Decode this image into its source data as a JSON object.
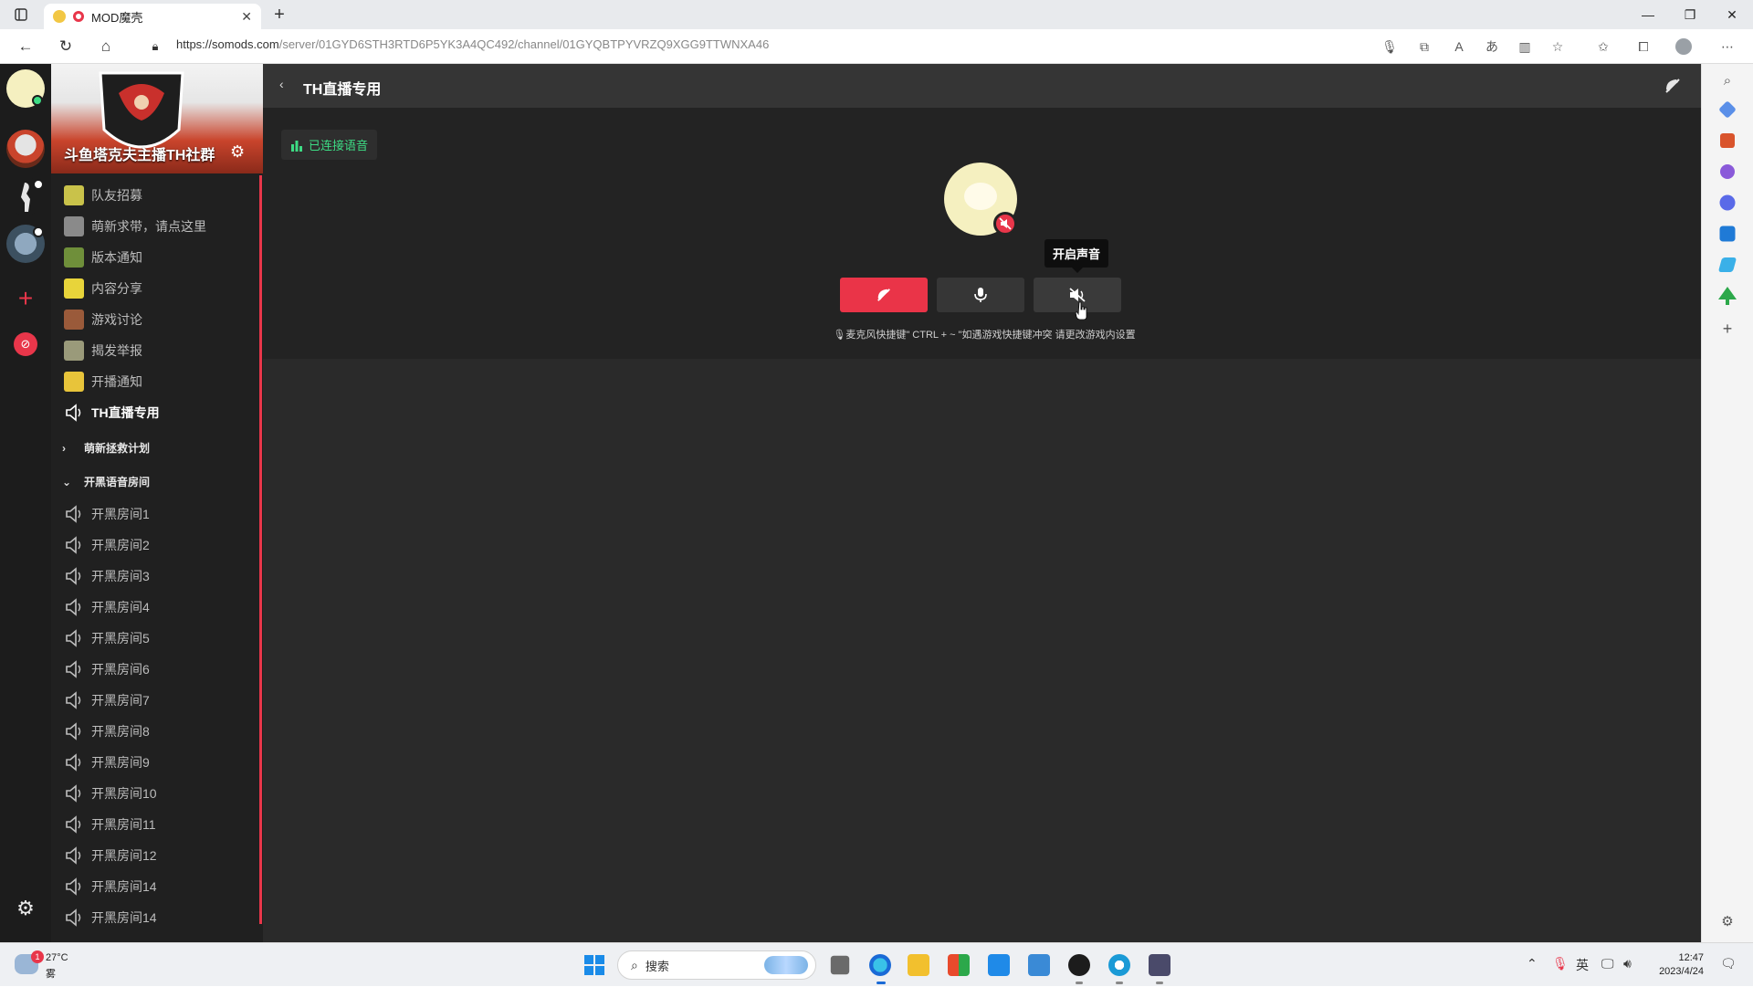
{
  "browser": {
    "tab_title": "MOD魔壳",
    "url_host": "https://somods.com",
    "url_path": "/server/01GYD6STH3RTD6P5YK3A4QC492/channel/01GYQBTPYVRZQ9XGG9TTWNXA46"
  },
  "server": {
    "name": "斗鱼塔克夫主播TH社群"
  },
  "channels": [
    {
      "label": "队友招募",
      "color": "#c9c24a"
    },
    {
      "label": "萌新求带，请点这里",
      "color": "#8a8a8a"
    },
    {
      "label": "版本通知",
      "color": "#6f8f3a"
    },
    {
      "label": "内容分享",
      "color": "#e8d43a"
    },
    {
      "label": "游戏讨论",
      "color": "#9a5a3a"
    },
    {
      "label": "揭发举报",
      "color": "#9a9a7a"
    },
    {
      "label": "开播通知",
      "color": "#e8c43a"
    }
  ],
  "active_channel": "TH直播专用",
  "categories": {
    "collapsed": "萌新拯救计划",
    "expanded": "开黑语音房间"
  },
  "voice_rooms": [
    "开黑房间1",
    "开黑房间2",
    "开黑房间3",
    "开黑房间4",
    "开黑房间5",
    "开黑房间6",
    "开黑房间7",
    "开黑房间8",
    "开黑房间9",
    "开黑房间10",
    "开黑房间11",
    "开黑房间12",
    "开黑房间14",
    "开黑房间14"
  ],
  "main": {
    "title": "TH直播专用",
    "connected_label": "已连接语音",
    "tooltip": "开启声音",
    "hint": "麦克风快捷键\" CTRL + ~ \"如遇游戏快捷键冲突 请更改游戏内设置"
  },
  "taskbar": {
    "temperature": "27°C",
    "weather": "雾",
    "weather_badge": "1",
    "search_placeholder": "搜索",
    "ime": "英",
    "time": "12:47",
    "date": "2023/4/24"
  },
  "colors": {
    "accent_red": "#ea3448",
    "connected_green": "#3ddc84"
  }
}
